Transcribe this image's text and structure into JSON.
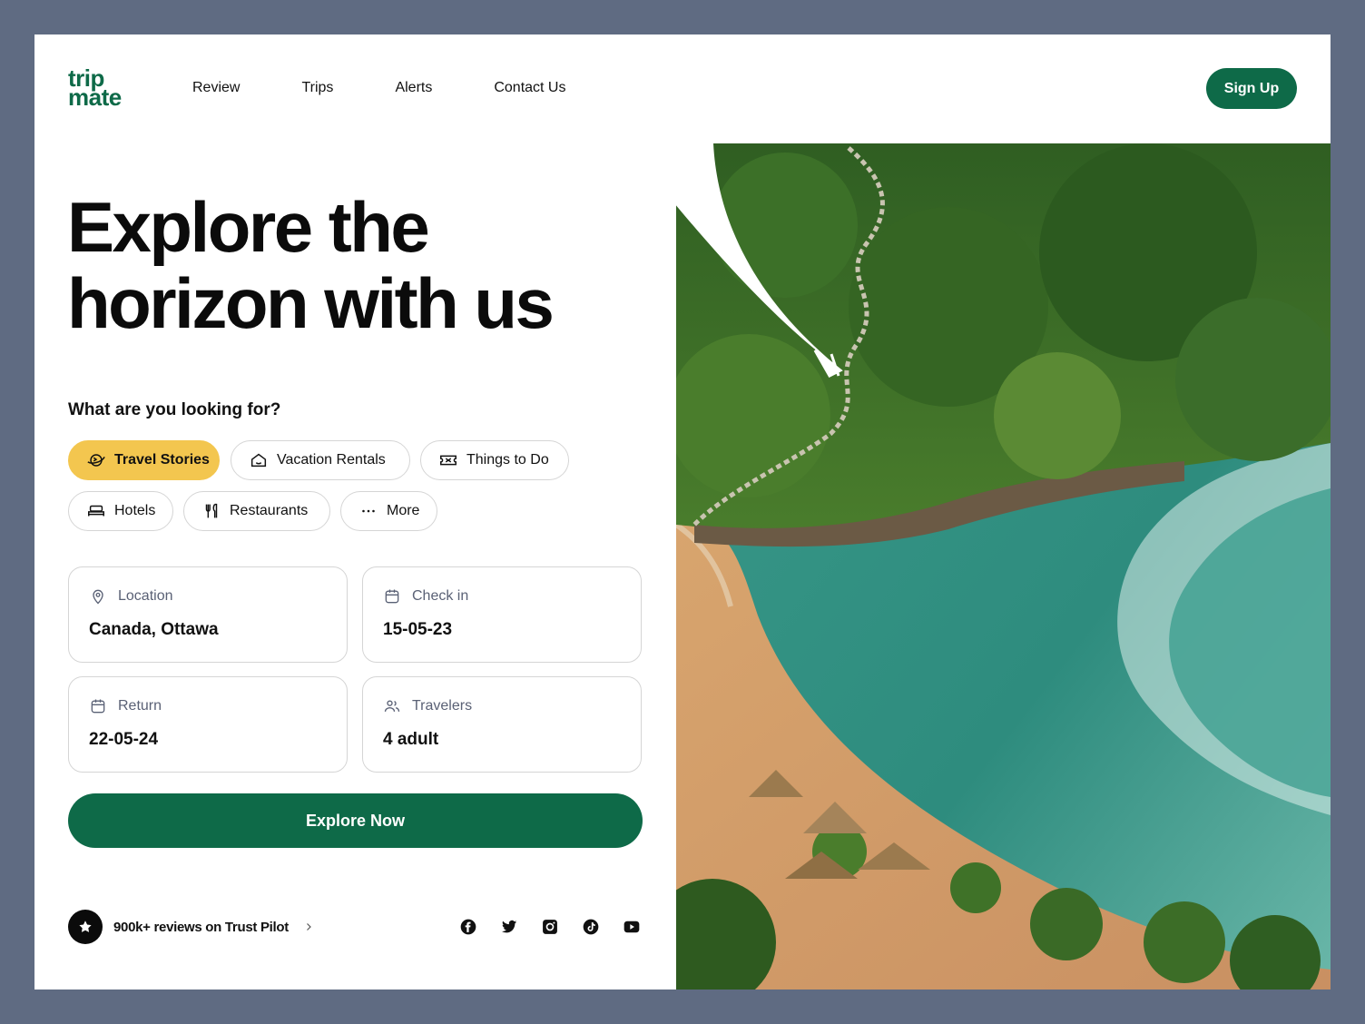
{
  "brand": {
    "line1": "trip",
    "line2": "mate",
    "color": "#0e6a48"
  },
  "nav": [
    "Review",
    "Trips",
    "Alerts",
    "Contact Us"
  ],
  "signup_label": "Sign Up",
  "hero": {
    "line1": "Explore the",
    "line2": "horizon with us"
  },
  "question": "What are you looking for?",
  "categories": [
    {
      "label": "Travel Stories",
      "icon": "globe-plane-icon",
      "active": true
    },
    {
      "label": "Vacation Rentals",
      "icon": "house-icon",
      "active": false
    },
    {
      "label": "Things to Do",
      "icon": "ticket-icon",
      "active": false
    },
    {
      "label": "Hotels",
      "icon": "bed-icon",
      "active": false
    },
    {
      "label": "Restaurants",
      "icon": "fork-knife-icon",
      "active": false
    },
    {
      "label": "More",
      "icon": "more-dots-icon",
      "active": false
    }
  ],
  "fields": {
    "location": {
      "label": "Location",
      "value": "Canada, Ottawa",
      "icon": "location-pin-icon"
    },
    "checkin": {
      "label": "Check in",
      "value": "15-05-23",
      "icon": "calendar-icon"
    },
    "return": {
      "label": "Return",
      "value": "22-05-24",
      "icon": "calendar-icon"
    },
    "travelers": {
      "label": "Travelers",
      "value": "4 adult",
      "icon": "users-icon"
    }
  },
  "explore_label": "Explore Now",
  "trust": {
    "text": "900k+ reviews on Trust Pilot",
    "icon": "star-icon"
  },
  "socials": [
    "facebook-icon",
    "twitter-icon",
    "instagram-icon",
    "tiktok-icon",
    "youtube-icon"
  ],
  "colors": {
    "accent": "#0e6a48",
    "chip_active": "#f3c64f",
    "backdrop": "#5f6b82"
  }
}
